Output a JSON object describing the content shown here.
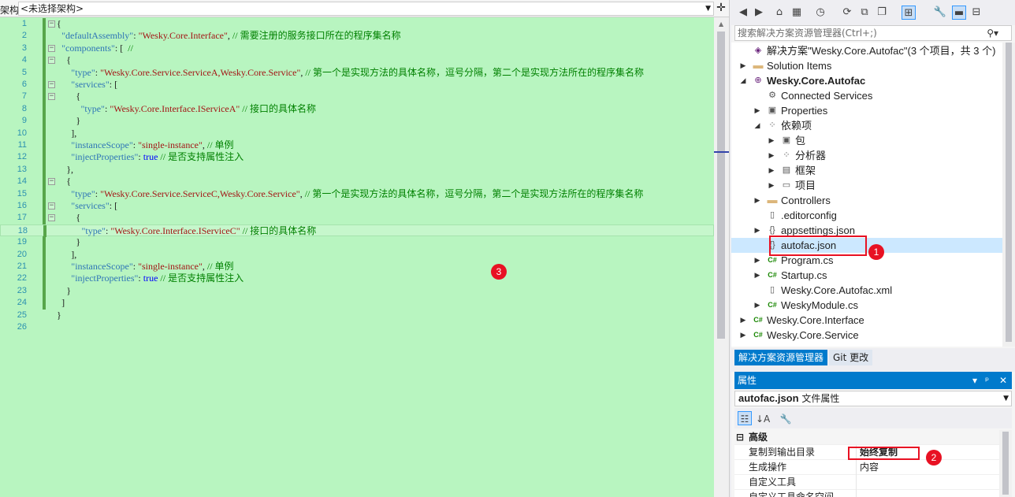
{
  "editor": {
    "nav_label": "架构:",
    "nav_value": "<未选择架构>",
    "current_line": 18,
    "lines": [
      {
        "n": "1",
        "indent": 0,
        "fold": "-",
        "parts": [
          {
            "t": "{",
            "c": "p"
          }
        ]
      },
      {
        "n": "2",
        "indent": 1,
        "parts": [
          {
            "t": "\"defaultAssembly\"",
            "c": "k"
          },
          {
            "t": ": ",
            "c": "p"
          },
          {
            "t": "\"Wesky.Core.Interface\"",
            "c": "s"
          },
          {
            "t": ", ",
            "c": "p"
          },
          {
            "t": "// 需要注册的服务接口所在的程序集名称",
            "c": "c"
          }
        ]
      },
      {
        "n": "3",
        "indent": 1,
        "fold": "-",
        "parts": [
          {
            "t": "\"components\"",
            "c": "k"
          },
          {
            "t": ": [  ",
            "c": "p"
          },
          {
            "t": "//",
            "c": "c"
          }
        ]
      },
      {
        "n": "4",
        "indent": 2,
        "fold": "-",
        "parts": [
          {
            "t": "{",
            "c": "p"
          }
        ]
      },
      {
        "n": "5",
        "indent": 3,
        "parts": [
          {
            "t": "\"type\"",
            "c": "k"
          },
          {
            "t": ": ",
            "c": "p"
          },
          {
            "t": "\"Wesky.Core.Service.ServiceA,Wesky.Core.Service\"",
            "c": "s"
          },
          {
            "t": ", ",
            "c": "p"
          },
          {
            "t": "// 第一个是实现方法的具体名称，逗号分隔，第二个是实现方法所在的程序集名称",
            "c": "c"
          }
        ]
      },
      {
        "n": "6",
        "indent": 3,
        "fold": "-",
        "parts": [
          {
            "t": "\"services\"",
            "c": "k"
          },
          {
            "t": ": [",
            "c": "p"
          }
        ]
      },
      {
        "n": "7",
        "indent": 4,
        "fold": "-",
        "parts": [
          {
            "t": "{",
            "c": "p"
          }
        ]
      },
      {
        "n": "8",
        "indent": 5,
        "parts": [
          {
            "t": "\"type\"",
            "c": "k"
          },
          {
            "t": ": ",
            "c": "p"
          },
          {
            "t": "\"Wesky.Core.Interface.IServiceA\"",
            "c": "s"
          },
          {
            "t": " ",
            "c": "p"
          },
          {
            "t": "// 接口的具体名称",
            "c": "c"
          }
        ]
      },
      {
        "n": "9",
        "indent": 4,
        "parts": [
          {
            "t": "}",
            "c": "p"
          }
        ]
      },
      {
        "n": "10",
        "indent": 3,
        "parts": [
          {
            "t": "],",
            "c": "p"
          }
        ]
      },
      {
        "n": "11",
        "indent": 3,
        "parts": [
          {
            "t": "\"instanceScope\"",
            "c": "k"
          },
          {
            "t": ": ",
            "c": "p"
          },
          {
            "t": "\"single-instance\"",
            "c": "s"
          },
          {
            "t": ", ",
            "c": "p"
          },
          {
            "t": "// 单例",
            "c": "c"
          }
        ]
      },
      {
        "n": "12",
        "indent": 3,
        "parts": [
          {
            "t": "\"injectProperties\"",
            "c": "k"
          },
          {
            "t": ": ",
            "c": "p"
          },
          {
            "t": "true",
            "c": "b"
          },
          {
            "t": " ",
            "c": "p"
          },
          {
            "t": "// 是否支持属性注入",
            "c": "c"
          }
        ]
      },
      {
        "n": "13",
        "indent": 2,
        "parts": [
          {
            "t": "},",
            "c": "p"
          }
        ]
      },
      {
        "n": "14",
        "indent": 2,
        "fold": "-",
        "parts": [
          {
            "t": "{",
            "c": "p"
          }
        ]
      },
      {
        "n": "15",
        "indent": 3,
        "parts": [
          {
            "t": "\"type\"",
            "c": "k"
          },
          {
            "t": ": ",
            "c": "p"
          },
          {
            "t": "\"Wesky.Core.Service.ServiceC,Wesky.Core.Service\"",
            "c": "s"
          },
          {
            "t": ", ",
            "c": "p"
          },
          {
            "t": "// 第一个是实现方法的具体名称，逗号分隔，第二个是实现方法所在的程序集名称",
            "c": "c"
          }
        ]
      },
      {
        "n": "16",
        "indent": 3,
        "fold": "-",
        "parts": [
          {
            "t": "\"services\"",
            "c": "k"
          },
          {
            "t": ": [",
            "c": "p"
          }
        ]
      },
      {
        "n": "17",
        "indent": 4,
        "fold": "-",
        "parts": [
          {
            "t": "{",
            "c": "p"
          }
        ]
      },
      {
        "n": "18",
        "indent": 5,
        "parts": [
          {
            "t": "\"type\"",
            "c": "k"
          },
          {
            "t": ": ",
            "c": "p"
          },
          {
            "t": "\"Wesky.Core.Interface.IServiceC\"",
            "c": "s"
          },
          {
            "t": " ",
            "c": "p"
          },
          {
            "t": "// 接口的具体名称",
            "c": "c"
          }
        ]
      },
      {
        "n": "19",
        "indent": 4,
        "parts": [
          {
            "t": "}",
            "c": "p"
          }
        ]
      },
      {
        "n": "20",
        "indent": 3,
        "parts": [
          {
            "t": "],",
            "c": "p"
          }
        ]
      },
      {
        "n": "21",
        "indent": 3,
        "parts": [
          {
            "t": "\"instanceScope\"",
            "c": "k"
          },
          {
            "t": ": ",
            "c": "p"
          },
          {
            "t": "\"single-instance\"",
            "c": "s"
          },
          {
            "t": ", ",
            "c": "p"
          },
          {
            "t": "// 单例",
            "c": "c"
          }
        ]
      },
      {
        "n": "22",
        "indent": 3,
        "parts": [
          {
            "t": "\"injectProperties\"",
            "c": "k"
          },
          {
            "t": ": ",
            "c": "p"
          },
          {
            "t": "true",
            "c": "b"
          },
          {
            "t": " ",
            "c": "p"
          },
          {
            "t": "// 是否支持属性注入",
            "c": "c"
          }
        ]
      },
      {
        "n": "23",
        "indent": 2,
        "parts": [
          {
            "t": "}",
            "c": "p"
          }
        ]
      },
      {
        "n": "24",
        "indent": 1,
        "parts": [
          {
            "t": "]",
            "c": "p"
          }
        ]
      },
      {
        "n": "25",
        "indent": 0,
        "parts": [
          {
            "t": "}",
            "c": "p"
          }
        ]
      },
      {
        "n": "26",
        "indent": 0,
        "parts": []
      }
    ]
  },
  "badges": {
    "one": "1",
    "two": "2",
    "three": "3"
  },
  "solution_explorer": {
    "search_placeholder": "搜索解决方案资源管理器(Ctrl+;)",
    "nodes": [
      {
        "label": "解决方案\"Wesky.Core.Autofac\"(3 个项目，共 3 个)",
        "level": 0,
        "exp": "",
        "icon": "solution",
        "glyph": "◈"
      },
      {
        "label": "Solution Items",
        "level": 0,
        "exp": "▶",
        "icon": "folder",
        "glyph": "▬"
      },
      {
        "label": "Wesky.Core.Autofac",
        "level": 0,
        "exp": "◢",
        "icon": "project",
        "glyph": "⊕",
        "bold": true
      },
      {
        "label": "Connected Services",
        "level": 1,
        "exp": "",
        "icon": "connected",
        "glyph": "⚙"
      },
      {
        "label": "Properties",
        "level": 1,
        "exp": "▶",
        "icon": "properties",
        "glyph": "▣"
      },
      {
        "label": "依赖项",
        "level": 1,
        "exp": "◢",
        "icon": "dependencies",
        "glyph": "⁘"
      },
      {
        "label": "包",
        "level": 2,
        "exp": "▶",
        "icon": "package",
        "glyph": "▣"
      },
      {
        "label": "分析器",
        "level": 2,
        "exp": "▶",
        "icon": "analyzer",
        "glyph": "⁘"
      },
      {
        "label": "框架",
        "level": 2,
        "exp": "▶",
        "icon": "framework",
        "glyph": "▤"
      },
      {
        "label": "项目",
        "level": 2,
        "exp": "▶",
        "icon": "project-ref",
        "glyph": "▭"
      },
      {
        "label": "Controllers",
        "level": 1,
        "exp": "▶",
        "icon": "folder",
        "glyph": "▬"
      },
      {
        "label": ".editorconfig",
        "level": 1,
        "exp": "",
        "icon": "file",
        "glyph": "▯"
      },
      {
        "label": "appsettings.json",
        "level": 1,
        "exp": "▶",
        "icon": "json-file",
        "glyph": "{}"
      },
      {
        "label": "autofac.json",
        "level": 1,
        "exp": "",
        "icon": "json-file",
        "glyph": "{}",
        "selected": true
      },
      {
        "label": "Program.cs",
        "level": 1,
        "exp": "▶",
        "icon": "csharp-file",
        "glyph": "C#"
      },
      {
        "label": "Startup.cs",
        "level": 1,
        "exp": "▶",
        "icon": "csharp-file",
        "glyph": "C#"
      },
      {
        "label": "Wesky.Core.Autofac.xml",
        "level": 1,
        "exp": "",
        "icon": "xml-file",
        "glyph": "▯"
      },
      {
        "label": "WeskyModule.cs",
        "level": 1,
        "exp": "▶",
        "icon": "csharp-file",
        "glyph": "C#"
      },
      {
        "label": "Wesky.Core.Interface",
        "level": 0,
        "exp": "▶",
        "icon": "csharp-project",
        "glyph": "C#"
      },
      {
        "label": "Wesky.Core.Service",
        "level": 0,
        "exp": "▶",
        "icon": "csharp-project",
        "glyph": "C#"
      }
    ],
    "tabs": [
      {
        "label": "解决方案资源管理器",
        "active": true
      },
      {
        "label": "Git 更改",
        "active": false
      }
    ]
  },
  "properties": {
    "title": "属性",
    "subject_name": "autofac.json",
    "subject_type": "文件属性",
    "category": "高级",
    "rows": [
      {
        "name": "复制到输出目录",
        "value": "始终复制",
        "bold": true
      },
      {
        "name": "生成操作",
        "value": "内容"
      },
      {
        "name": "自定义工具",
        "value": ""
      },
      {
        "name": "自定义工具命名空间",
        "value": ""
      }
    ]
  }
}
